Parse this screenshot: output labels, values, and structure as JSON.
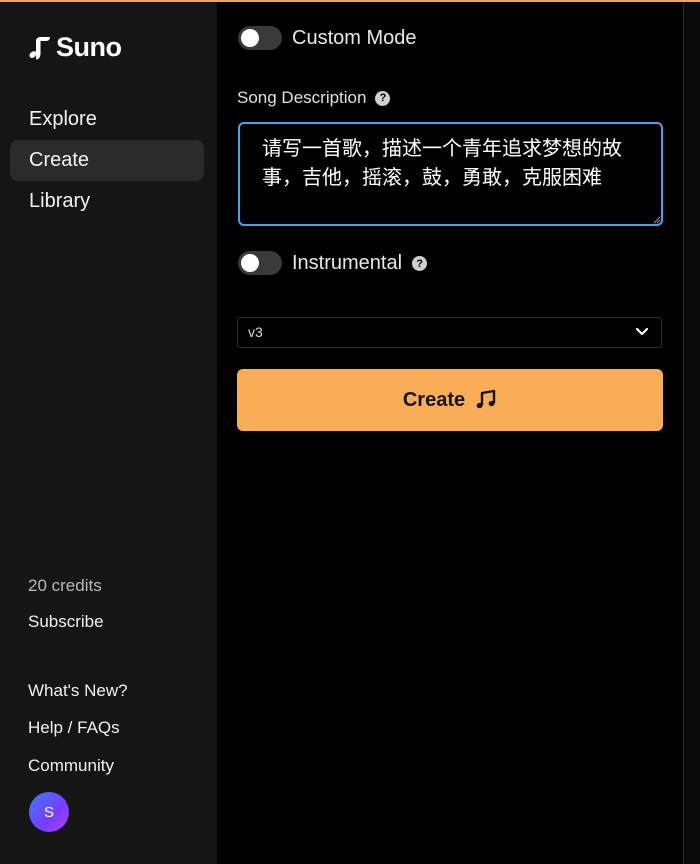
{
  "brand": {
    "name": "Suno"
  },
  "nav": {
    "items": [
      {
        "label": "Explore",
        "active": false
      },
      {
        "label": "Create",
        "active": true
      },
      {
        "label": "Library",
        "active": false
      }
    ]
  },
  "account": {
    "credits": "20 credits",
    "subscribe": "Subscribe",
    "avatar_initial": "S"
  },
  "footer_links": [
    "What's New?",
    "Help / FAQs",
    "Community"
  ],
  "form": {
    "custom_mode": {
      "label": "Custom Mode",
      "on": false
    },
    "song_description": {
      "label": "Song Description",
      "value": "请写一首歌，描述一个青年追求梦想的故事，吉他，摇滚，鼓，勇敢，克服困难"
    },
    "instrumental": {
      "label": "Instrumental",
      "on": false
    },
    "model_select": {
      "value": "v3"
    },
    "create_button": {
      "label": "Create"
    }
  },
  "colors": {
    "accent": "#f8ad56",
    "focus_border": "#4aa3f0",
    "sidebar_bg": "#151515",
    "active_nav_bg": "#2b2b2b"
  },
  "icons": {
    "logo": "music-note-icon",
    "help": "question-circle-icon",
    "select_caret": "chevron-down-icon",
    "create": "music-note-icon"
  }
}
